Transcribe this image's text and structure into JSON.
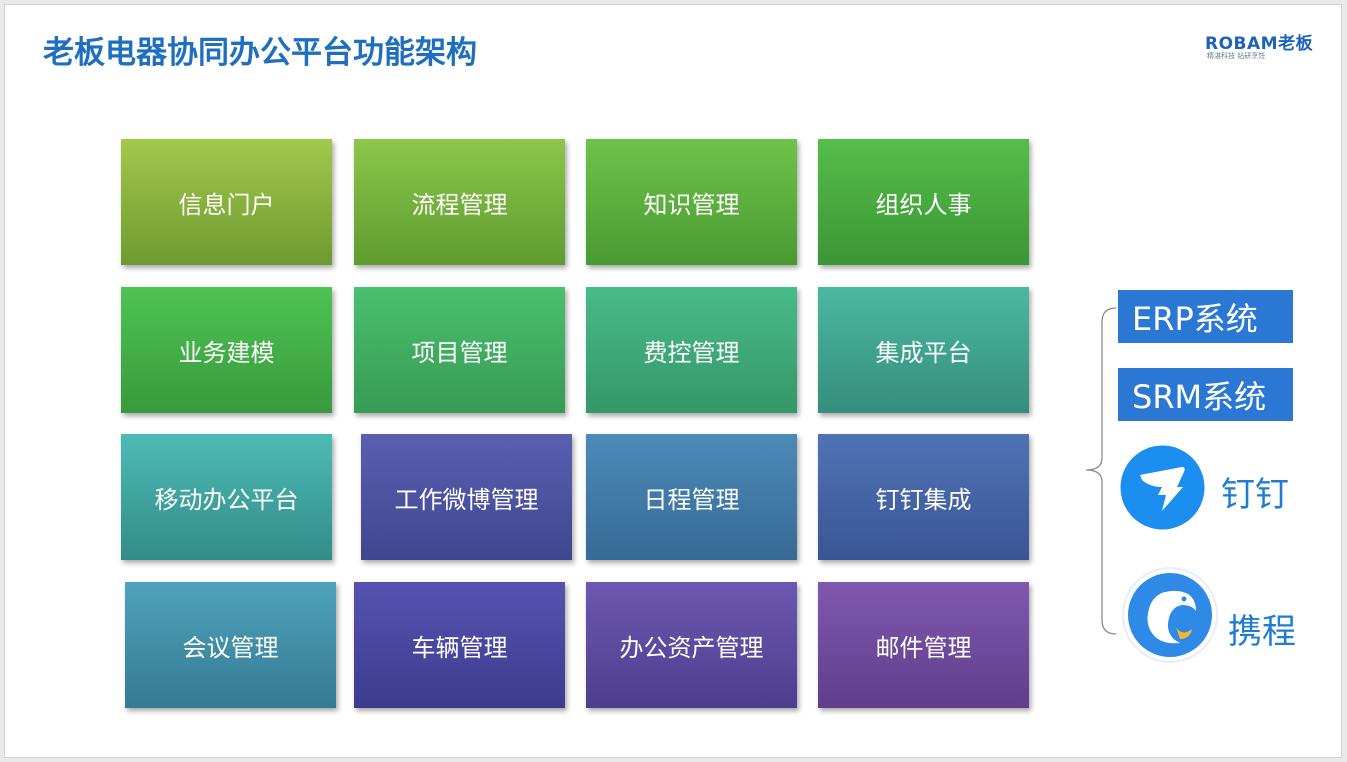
{
  "title": "老板电器协同办公平台功能架构",
  "logo": {
    "main": "ROBAM老板",
    "sub": "精湛科技  钻研烹饪"
  },
  "grid": [
    [
      "信息门户",
      "流程管理",
      "知识管理",
      "组织人事"
    ],
    [
      "业务建模",
      "项目管理",
      "费控管理",
      "集成平台"
    ],
    [
      "移动办公平台",
      "工作微博管理",
      "日程管理",
      "钉钉集成"
    ],
    [
      "会议管理",
      "车辆管理",
      "办公资产管理",
      "邮件管理"
    ]
  ],
  "integrations": {
    "erp_label": "ERP系统",
    "srm_label": "SRM系统",
    "dingtalk_label": "钉钉",
    "ctrip_label": "携程"
  },
  "colors": {
    "title": "#1f6fc0",
    "system_box": "#2a78d4",
    "app_label": "#1f7cd4"
  },
  "icons": {
    "dingtalk": "dingtalk-icon",
    "ctrip": "ctrip-dolphin-icon"
  }
}
